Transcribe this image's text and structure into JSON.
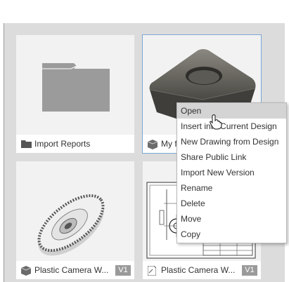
{
  "cards": [
    {
      "title": "Import Reports",
      "icon": "folder-icon"
    },
    {
      "title": "My f",
      "icon": "3d-model-icon"
    },
    {
      "title": "Plastic Camera W...",
      "badge": "V1",
      "icon": "3d-model-icon"
    },
    {
      "title": "Plastic Camera W...",
      "badge": "V1",
      "icon": "drawing-icon"
    }
  ],
  "context_menu": {
    "items": [
      {
        "label": "Open",
        "highlighted": true
      },
      {
        "label": "Insert into Current Design"
      },
      {
        "label": "New Drawing from Design"
      },
      {
        "label": "Share Public Link"
      },
      {
        "label": "Import New Version"
      },
      {
        "label": "Rename"
      },
      {
        "label": "Delete"
      },
      {
        "label": "Move"
      },
      {
        "label": "Copy"
      }
    ]
  },
  "colors": {
    "selection_border": "#7aa7d6",
    "menu_hover": "#d4d4d4",
    "badge_bg": "#9a9a9a"
  }
}
